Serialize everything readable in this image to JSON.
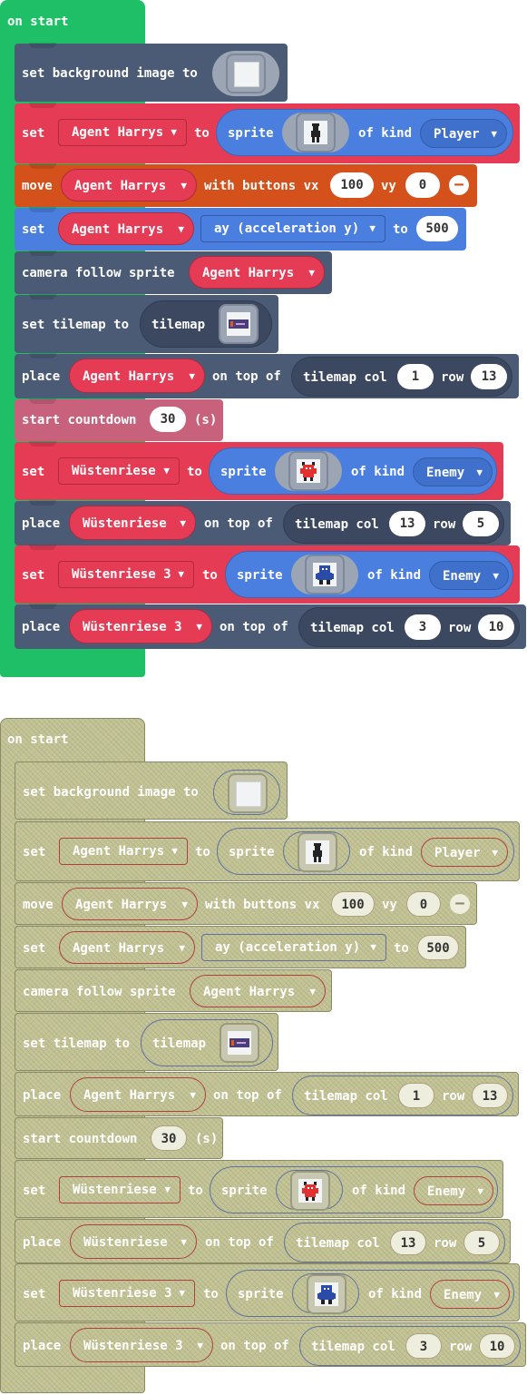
{
  "top": {
    "hat_label": "on start",
    "b1": {
      "label": "set background image to"
    },
    "b2": {
      "set": "set",
      "var": "Agent Harrys",
      "to": "to",
      "sprite": "sprite",
      "of_kind": "of kind",
      "kind": "Player"
    },
    "b3": {
      "move": "move",
      "var": "Agent Harrys",
      "with_buttons": "with buttons vx",
      "vx": "100",
      "vy_label": "vy",
      "vy": "0"
    },
    "b4": {
      "set": "set",
      "var": "Agent Harrys",
      "prop": "ay (acceleration y)",
      "to": "to",
      "value": "500"
    },
    "b5": {
      "label": "camera follow sprite",
      "var": "Agent Harrys"
    },
    "b6": {
      "label": "set tilemap to",
      "tilemap": "tilemap"
    },
    "b7": {
      "place": "place",
      "var": "Agent Harrys",
      "on_top": "on top of",
      "tilemap_col": "tilemap col",
      "col": "1",
      "row_label": "row",
      "row": "13"
    },
    "b8": {
      "label": "start countdown",
      "value": "30",
      "unit": "(s)"
    },
    "b9": {
      "set": "set",
      "var": "Wüstenriese",
      "to": "to",
      "sprite": "sprite",
      "of_kind": "of kind",
      "kind": "Enemy"
    },
    "b10": {
      "place": "place",
      "var": "Wüstenriese",
      "on_top": "on top of",
      "tilemap_col": "tilemap col",
      "col": "13",
      "row_label": "row",
      "row": "5"
    },
    "b11": {
      "set": "set",
      "var": "Wüstenriese 3",
      "to": "to",
      "sprite": "sprite",
      "of_kind": "of kind",
      "kind": "Enemy"
    },
    "b12": {
      "place": "place",
      "var": "Wüstenriese 3",
      "on_top": "on top of",
      "tilemap_col": "tilemap col",
      "col": "3",
      "row_label": "row",
      "row": "10"
    }
  },
  "bottom": {
    "hat_label": "on start",
    "b1": {
      "label": "set background image to"
    },
    "b2": {
      "set": "set",
      "var": "Agent Harrys",
      "to": "to",
      "sprite": "sprite",
      "of_kind": "of kind",
      "kind": "Player"
    },
    "b3": {
      "move": "move",
      "var": "Agent Harrys",
      "with_buttons": "with buttons vx",
      "vx": "100",
      "vy_label": "vy",
      "vy": "0"
    },
    "b4": {
      "set": "set",
      "var": "Agent Harrys",
      "prop": "ay (acceleration y)",
      "to": "to",
      "value": "500"
    },
    "b5": {
      "label": "camera follow sprite",
      "var": "Agent Harrys"
    },
    "b6": {
      "label": "set tilemap to",
      "tilemap": "tilemap"
    },
    "b7": {
      "place": "place",
      "var": "Agent Harrys",
      "on_top": "on top of",
      "tilemap_col": "tilemap col",
      "col": "1",
      "row_label": "row",
      "row": "13"
    },
    "b8": {
      "label": "start countdown",
      "value": "30",
      "unit": "(s)"
    },
    "b9": {
      "set": "set",
      "var": "Wüstenriese",
      "to": "to",
      "sprite": "sprite",
      "of_kind": "of kind",
      "kind": "Enemy"
    },
    "b10": {
      "place": "place",
      "var": "Wüstenriese",
      "on_top": "on top of",
      "tilemap_col": "tilemap col",
      "col": "13",
      "row_label": "row",
      "row": "5"
    },
    "b11": {
      "set": "set",
      "var": "Wüstenriese 3",
      "to": "to",
      "sprite": "sprite",
      "of_kind": "of kind",
      "kind": "Enemy"
    },
    "b12": {
      "place": "place",
      "var": "Wüstenriese 3",
      "on_top": "on top of",
      "tilemap_col": "tilemap col",
      "col": "3",
      "row_label": "row",
      "row": "10"
    }
  },
  "icons": {
    "dropdown": "▼",
    "remove": "−",
    "background_image": "background-image-thumbnail",
    "player_sprite": "agent-sprite-thumbnail",
    "enemy_sprite": "red-monster-sprite-thumbnail",
    "enemy3_sprite": "blue-monster-sprite-thumbnail",
    "tilemap": "tilemap-thumbnail"
  },
  "colors": {
    "event": "#1fbf68",
    "scene": "#4b5b76",
    "sprite": "#e63b55",
    "sprite_kind": "#4a7fe0",
    "controller": "#d4511c",
    "info": "#c8627c",
    "faded": "#c6c692"
  }
}
